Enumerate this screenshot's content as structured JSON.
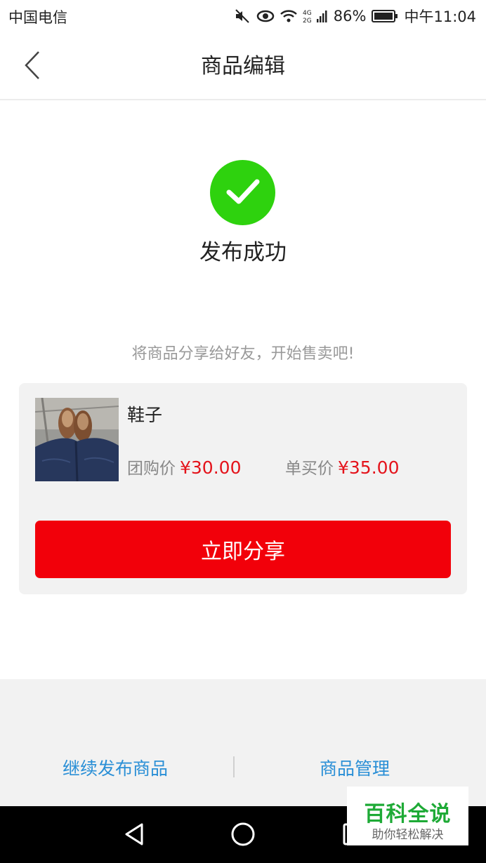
{
  "status_bar": {
    "carrier": "中国电信",
    "network": "4G",
    "battery": "86%",
    "time": "中午11:04",
    "icons": [
      "mute-icon",
      "eye-icon",
      "wifi-icon",
      "signal-icon",
      "battery-icon"
    ]
  },
  "nav": {
    "title": "商品编辑",
    "back_icon": "chevron-left-icon"
  },
  "success": {
    "icon": "check-icon",
    "color": "#2ed20e",
    "title": "发布成功"
  },
  "share_hint": "将商品分享给好友，开始售卖吧!",
  "product": {
    "name": "鞋子",
    "group_price_label": "团购价",
    "group_price": "¥30.00",
    "single_price_label": "单买价",
    "single_price": "¥35.00",
    "price_color": "#e4131b"
  },
  "share_button": {
    "label": "立即分享",
    "color": "#f2000a"
  },
  "bottom_actions": {
    "continue_label": "继续发布商品",
    "manage_label": "商品管理",
    "link_color": "#2a8fd6"
  },
  "android_nav": {
    "icons": [
      "back-triangle-icon",
      "home-circle-icon",
      "recent-square-icon"
    ]
  },
  "watermark": {
    "title": "百科全说",
    "subtitle": "助你轻松解决"
  }
}
